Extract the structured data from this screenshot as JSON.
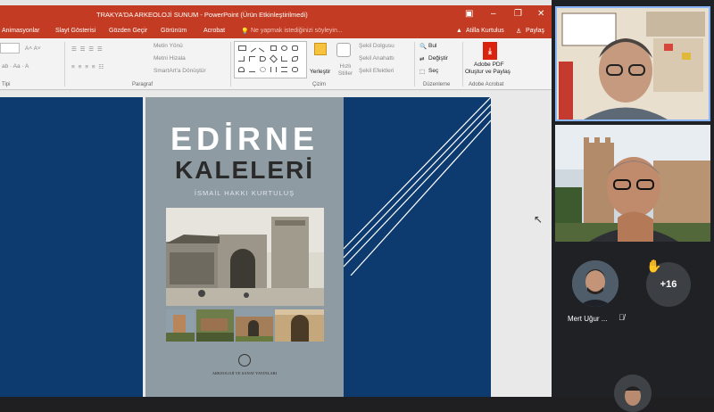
{
  "ppt": {
    "title": "TRAKYA'DA ARKEOLOJİ SUNUM - PowerPoint (Ürün Etkinleştirilmedi)",
    "tabs": [
      "Animasyonlar",
      "Slayt Gösterisi",
      "Gözden Geçir",
      "Görünüm",
      "Acrobat"
    ],
    "tell_me": "Ne yapmak istediğinizi söyleyin...",
    "user": "Atilla Kurtulus",
    "share": "Paylaş",
    "ribbon": {
      "paragraph_label": "Paragraf",
      "drawing_label": "Çizim",
      "editing_label": "Düzenleme",
      "acrobat_label": "Adobe Acrobat",
      "text_direction": "Metin Yönü",
      "align_text": "Metni Hizala",
      "smartart": "SmartArt'a Dönüştür",
      "arrange": "Yerleştir",
      "quick_styles": "Hızlı Stiller",
      "shape_fill": "Şekil Dolgusu",
      "shape_outline": "Şekil Anahattı",
      "shape_effects": "Şekil Efektleri",
      "find": "Bul",
      "replace": "Değiştir",
      "select": "Seç",
      "pdf_line1": "Adobe PDF",
      "pdf_line2": "Oluştur ve Paylaş",
      "font_label": "Tipi"
    }
  },
  "slide": {
    "title_line1": "EDİRNE",
    "title_line2": "KALELERİ",
    "author": "İSMAİL HAKKI KURTULUŞ",
    "publisher": "ARKEOLOJİ VE SANAT YAYINLARI"
  },
  "participants": {
    "more_count": "+16",
    "named_participant": "Mert Uğur ..."
  },
  "colors": {
    "ppt_red": "#c23b22",
    "slide_blue": "#0d3a6f",
    "cover_gray": "#8e9ba2",
    "meet_dark": "#202124",
    "active_speaker": "#8ab4f8"
  }
}
